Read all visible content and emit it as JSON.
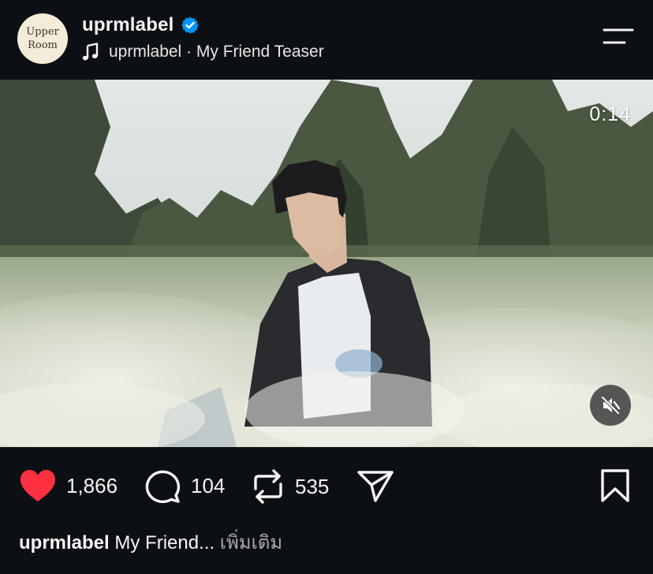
{
  "header": {
    "avatar_line1": "Upper",
    "avatar_line2": "Room",
    "username": "uprmlabel",
    "audio": "uprmlabel · My Friend Teaser"
  },
  "icons": {
    "verified": "verified-badge-icon",
    "music": "music-note-icon",
    "menu": "menu-icon",
    "mute": "muted-speaker-icon",
    "like": "heart-icon",
    "comment": "comment-icon",
    "repost": "repost-icon",
    "share": "share-icon",
    "bookmark": "bookmark-icon"
  },
  "video": {
    "timestamp": "0:14"
  },
  "actions": {
    "likes": "1,866",
    "comments": "104",
    "reposts": "535"
  },
  "caption": {
    "user": "uprmlabel",
    "text": "My Friend...",
    "more": "เพิ่มเติม"
  },
  "colors": {
    "background": "#0c1014",
    "like_red": "#ff3040",
    "verified_blue": "#0095f6",
    "secondary_text": "#a8a8a8"
  }
}
